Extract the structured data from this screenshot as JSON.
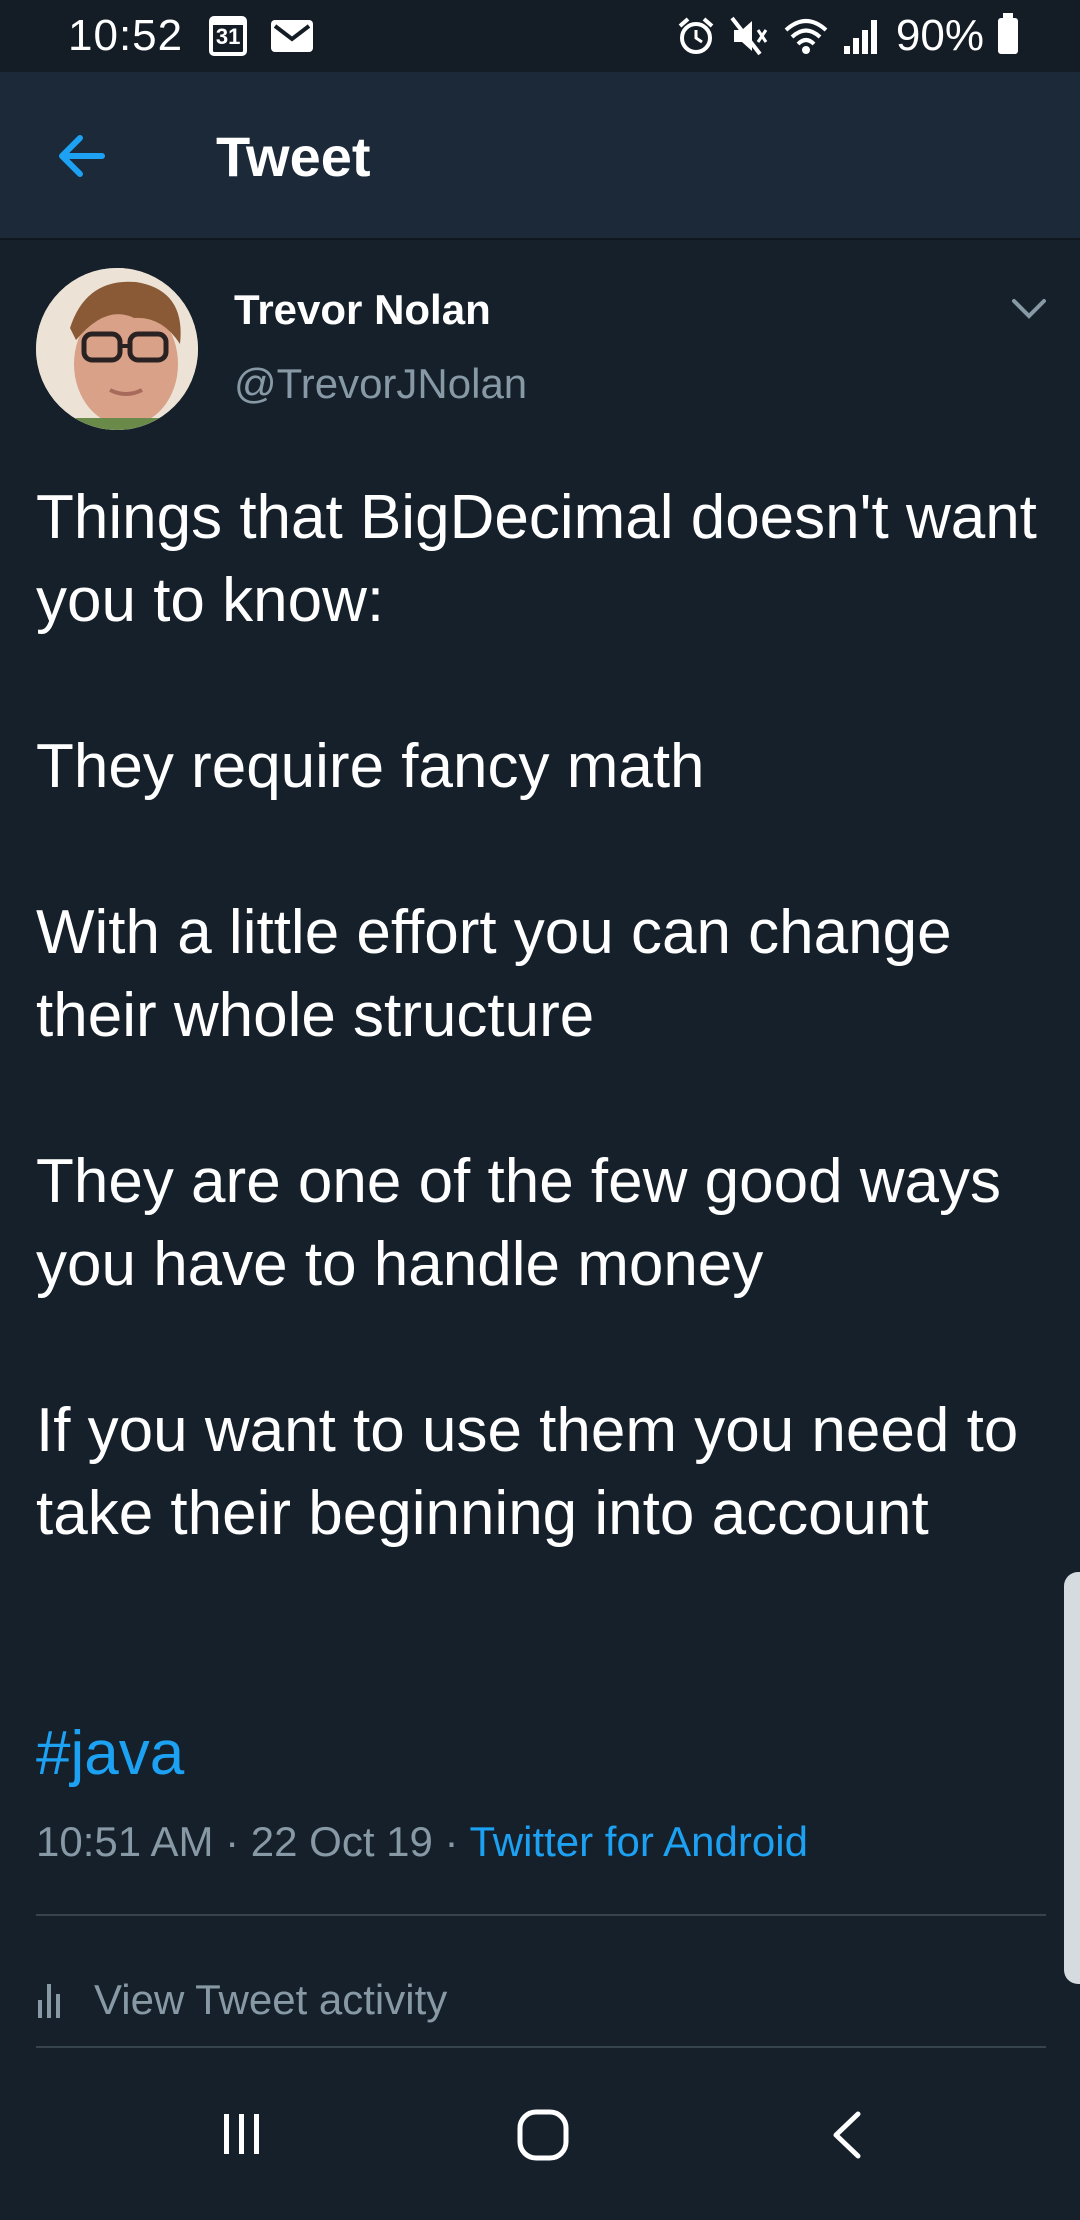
{
  "status_bar": {
    "time": "10:52",
    "calendar_day": "31",
    "battery": "90%"
  },
  "app_bar": {
    "title": "Tweet"
  },
  "tweet": {
    "user_name": "Trevor Nolan",
    "handle": "@TrevorJNolan",
    "paragraphs": [
      "Things that BigDecimal doesn't want you to know:",
      "They require fancy math",
      "With a little effort you can change their whole structure",
      "They are one of the few good ways you have to handle money",
      "If you want to use them you need to take their beginning into account"
    ],
    "hashtag": "#java",
    "timestamp": "10:51 AM · 22 Oct 19 · ",
    "source": "Twitter for Android"
  },
  "activity": {
    "label": "View Tweet activity"
  },
  "colors": {
    "background": "#15202b",
    "header": "#1c2938",
    "accent": "#1da1f2",
    "secondary_text": "#8899a6"
  },
  "icons": {
    "back": "back-arrow-icon",
    "caret": "chevron-down-icon",
    "stats": "stats-icon",
    "calendar": "calendar-icon",
    "mail": "mail-icon",
    "alarm": "alarm-icon",
    "mute": "mute-icon",
    "wifi": "wifi-icon",
    "signal": "signal-icon",
    "battery": "battery-icon"
  }
}
